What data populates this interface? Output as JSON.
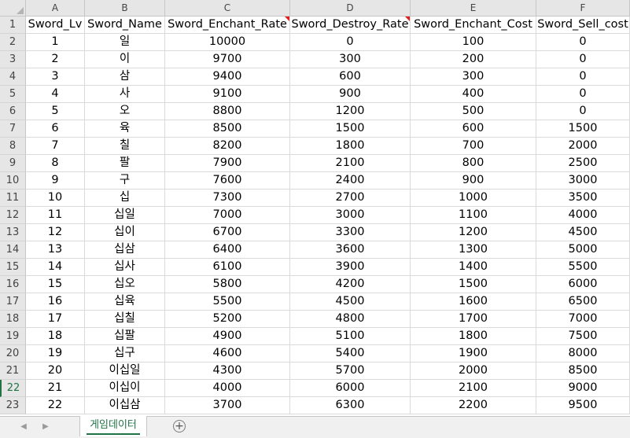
{
  "spreadsheet": {
    "columns": [
      "A",
      "B",
      "C",
      "D",
      "E",
      "F"
    ],
    "headers": [
      "Sword_Lv",
      "Sword_Name",
      "Sword_Enchant_Rate",
      "Sword_Destroy_Rate",
      "Sword_Enchant_Cost",
      "Sword_Sell_cost"
    ],
    "commented_headers": [
      2,
      3
    ],
    "selected_row": 22,
    "rows": [
      [
        "1",
        "일",
        "10000",
        "0",
        "100",
        "0"
      ],
      [
        "2",
        "이",
        "9700",
        "300",
        "200",
        "0"
      ],
      [
        "3",
        "삼",
        "9400",
        "600",
        "300",
        "0"
      ],
      [
        "4",
        "사",
        "9100",
        "900",
        "400",
        "0"
      ],
      [
        "5",
        "오",
        "8800",
        "1200",
        "500",
        "0"
      ],
      [
        "6",
        "육",
        "8500",
        "1500",
        "600",
        "1500"
      ],
      [
        "7",
        "칠",
        "8200",
        "1800",
        "700",
        "2000"
      ],
      [
        "8",
        "팔",
        "7900",
        "2100",
        "800",
        "2500"
      ],
      [
        "9",
        "구",
        "7600",
        "2400",
        "900",
        "3000"
      ],
      [
        "10",
        "십",
        "7300",
        "2700",
        "1000",
        "3500"
      ],
      [
        "11",
        "십일",
        "7000",
        "3000",
        "1100",
        "4000"
      ],
      [
        "12",
        "십이",
        "6700",
        "3300",
        "1200",
        "4500"
      ],
      [
        "13",
        "십삼",
        "6400",
        "3600",
        "1300",
        "5000"
      ],
      [
        "14",
        "십사",
        "6100",
        "3900",
        "1400",
        "5500"
      ],
      [
        "15",
        "십오",
        "5800",
        "4200",
        "1500",
        "6000"
      ],
      [
        "16",
        "십육",
        "5500",
        "4500",
        "1600",
        "6500"
      ],
      [
        "17",
        "십칠",
        "5200",
        "4800",
        "1700",
        "7000"
      ],
      [
        "18",
        "십팔",
        "4900",
        "5100",
        "1800",
        "7500"
      ],
      [
        "19",
        "십구",
        "4600",
        "5400",
        "1900",
        "8000"
      ],
      [
        "20",
        "이십일",
        "4300",
        "5700",
        "2000",
        "8500"
      ],
      [
        "21",
        "이십이",
        "4000",
        "6000",
        "2100",
        "9000"
      ],
      [
        "22",
        "이십삼",
        "3700",
        "6300",
        "2200",
        "9500"
      ]
    ]
  },
  "tabbar": {
    "prev_icon": "◀",
    "next_icon": "▶",
    "sheet_tab": "게임데이터",
    "add_icon": "+"
  },
  "colors": {
    "accent": "#217346",
    "comment_marker": "#e41b1b"
  }
}
